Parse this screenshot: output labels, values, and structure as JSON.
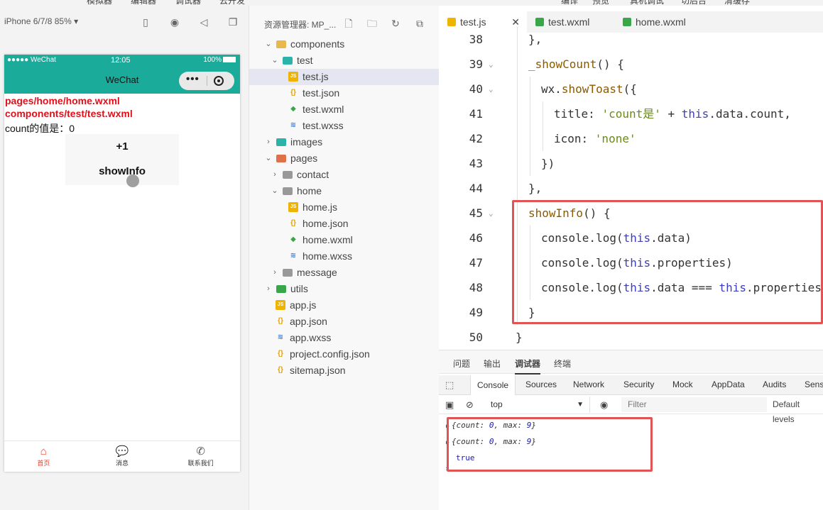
{
  "top_menu": [
    "模拟器",
    "编辑器",
    "调试器",
    "云开发",
    "编译",
    "预览",
    "真机调试",
    "切后台",
    "清缓存"
  ],
  "simulator": {
    "device_label": "iPhone 6/7/8 85% ▾",
    "icons": [
      "phone-icon",
      "record-icon",
      "speaker-icon",
      "window-icon"
    ],
    "status_left": "●●●●● WeChat",
    "status_time": "12:05",
    "status_battery": "100%",
    "nav_title": "WeChat",
    "capsule_dots": "•••",
    "page_lines": [
      "pages/home/home.wxml",
      "components/test/test.wxml"
    ],
    "count_line": "count的值是：0",
    "buttons": [
      "+1",
      "showInfo"
    ],
    "tabbar": [
      {
        "label": "首页",
        "icon": "home-icon",
        "active": true
      },
      {
        "label": "消息",
        "icon": "message-icon",
        "active": false
      },
      {
        "label": "联系我们",
        "icon": "phone-call-icon",
        "active": false
      }
    ]
  },
  "explorer": {
    "title": "资源管理器: MP_...",
    "icons": [
      "new-file-icon",
      "new-folder-icon",
      "refresh-icon",
      "collapse-icon"
    ],
    "tree": [
      {
        "label": "components",
        "indent": 1,
        "chevron": "v",
        "icon": "folder",
        "color": "#e8b84a"
      },
      {
        "label": "test",
        "indent": 2,
        "chevron": "v",
        "icon": "folder",
        "color": "#2bb3a8"
      },
      {
        "label": "test.js",
        "indent": 3,
        "chevron": "",
        "icon": "js",
        "color": "#f0b400",
        "selected": true
      },
      {
        "label": "test.json",
        "indent": 3,
        "chevron": "",
        "icon": "json",
        "color": "#e0a200"
      },
      {
        "label": "test.wxml",
        "indent": 3,
        "chevron": "",
        "icon": "wxml",
        "color": "#3aa64a"
      },
      {
        "label": "test.wxss",
        "indent": 3,
        "chevron": "",
        "icon": "wxss",
        "color": "#3a7bd5"
      },
      {
        "label": "images",
        "indent": 1,
        "chevron": ">",
        "icon": "folder",
        "color": "#2bb3a8"
      },
      {
        "label": "pages",
        "indent": 1,
        "chevron": "v",
        "icon": "folder",
        "color": "#e0704a"
      },
      {
        "label": "contact",
        "indent": 2,
        "chevron": ">",
        "icon": "folder",
        "color": "#999999"
      },
      {
        "label": "home",
        "indent": 2,
        "chevron": "v",
        "icon": "folder",
        "color": "#999999"
      },
      {
        "label": "home.js",
        "indent": 3,
        "chevron": "",
        "icon": "js",
        "color": "#f0b400"
      },
      {
        "label": "home.json",
        "indent": 3,
        "chevron": "",
        "icon": "json",
        "color": "#e0a200"
      },
      {
        "label": "home.wxml",
        "indent": 3,
        "chevron": "",
        "icon": "wxml",
        "color": "#3aa64a"
      },
      {
        "label": "home.wxss",
        "indent": 3,
        "chevron": "",
        "icon": "wxss",
        "color": "#3a7bd5"
      },
      {
        "label": "message",
        "indent": 2,
        "chevron": ">",
        "icon": "folder",
        "color": "#999999"
      },
      {
        "label": "utils",
        "indent": 1,
        "chevron": ">",
        "icon": "folder",
        "color": "#3aa64a"
      },
      {
        "label": "app.js",
        "indent": 1,
        "chevron": "",
        "icon": "js",
        "color": "#f0b400"
      },
      {
        "label": "app.json",
        "indent": 1,
        "chevron": "",
        "icon": "json",
        "color": "#e0a200"
      },
      {
        "label": "app.wxss",
        "indent": 1,
        "chevron": "",
        "icon": "wxss",
        "color": "#3a7bd5"
      },
      {
        "label": "project.config.json",
        "indent": 1,
        "chevron": "",
        "icon": "json",
        "color": "#e0a200"
      },
      {
        "label": "sitemap.json",
        "indent": 1,
        "chevron": "",
        "icon": "json",
        "color": "#e0a200"
      }
    ]
  },
  "editor": {
    "tabs": [
      {
        "label": "test.js",
        "color": "#f0b400",
        "active": true,
        "close": "✕"
      },
      {
        "label": "test.wxml",
        "color": "#3aa64a",
        "active": false
      },
      {
        "label": "home.wxml",
        "color": "#3aa64a",
        "active": false
      }
    ],
    "lines": [
      {
        "num": "38",
        "fold": false,
        "indent": 1,
        "code": "},"
      },
      {
        "num": "39",
        "fold": true,
        "indent": 1,
        "code": "_showCount() {"
      },
      {
        "num": "40",
        "fold": true,
        "indent": 2,
        "code": "wx.showToast({"
      },
      {
        "num": "41",
        "fold": false,
        "indent": 3,
        "code": "title: 'count是' + this.data.count,"
      },
      {
        "num": "42",
        "fold": false,
        "indent": 3,
        "code": "icon: 'none'"
      },
      {
        "num": "43",
        "fold": false,
        "indent": 2,
        "code": "})"
      },
      {
        "num": "44",
        "fold": false,
        "indent": 1,
        "code": "},"
      },
      {
        "num": "45",
        "fold": true,
        "indent": 1,
        "code": "showInfo() {"
      },
      {
        "num": "46",
        "fold": false,
        "indent": 2,
        "code": "console.log(this.data)"
      },
      {
        "num": "47",
        "fold": false,
        "indent": 2,
        "code": "console.log(this.properties)"
      },
      {
        "num": "48",
        "fold": false,
        "indent": 2,
        "code": "console.log(this.data === this.properties)"
      },
      {
        "num": "49",
        "fold": false,
        "indent": 1,
        "code": "}"
      },
      {
        "num": "50",
        "fold": false,
        "indent": 0,
        "code": "}"
      }
    ],
    "highlight_color": "#e05454"
  },
  "panel": {
    "tabs": [
      "问题",
      "输出",
      "调试器",
      "终端"
    ],
    "active_tab": "调试器",
    "devtools_tabs": [
      "Console",
      "Sources",
      "Network",
      "Security",
      "Mock",
      "AppData",
      "Audits",
      "Sens"
    ],
    "context": "top",
    "filter_placeholder": "Filter",
    "levels": "Default levels",
    "console_lines": [
      {
        "prefix": "{count: ",
        "v1": "0",
        "mid": ", max: ",
        "v2": "9",
        "suffix": "}"
      },
      {
        "prefix": "{count: ",
        "v1": "0",
        "mid": ", max: ",
        "v2": "9",
        "suffix": "}"
      }
    ],
    "bool_line": "true",
    "prompt": "›"
  }
}
